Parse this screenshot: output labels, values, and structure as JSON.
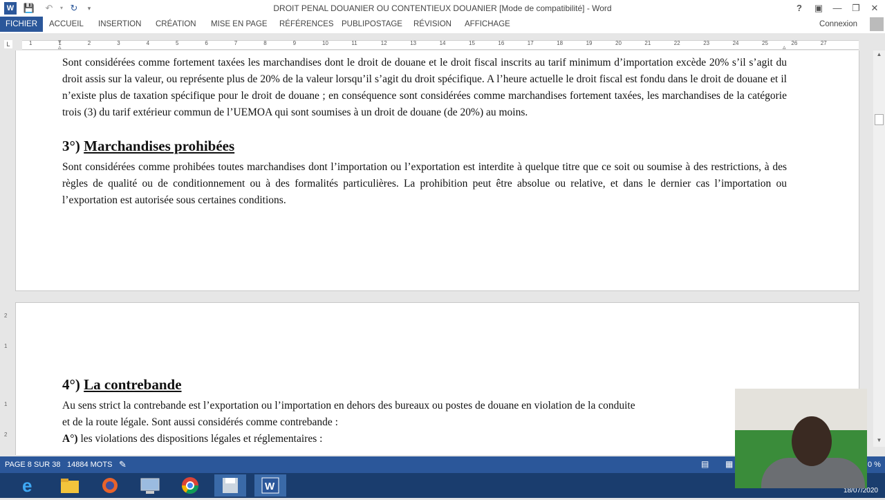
{
  "window": {
    "title": "DROIT PENAL DOUANIER OU CONTENTIEUX DOUANIER [Mode de compatibilité] - Word",
    "help": "?"
  },
  "ribbon": {
    "tabs": [
      "FICHIER",
      "ACCUEIL",
      "INSERTION",
      "CRÉATION",
      "MISE EN PAGE",
      "RÉFÉRENCES",
      "PUBLIPOSTAGE",
      "RÉVISION",
      "AFFICHAGE"
    ],
    "account": "Connexion"
  },
  "ruler": {
    "corner": "L",
    "ticks": [
      "1",
      "1",
      "2",
      "3",
      "4",
      "5",
      "6",
      "7",
      "8",
      "9",
      "10",
      "11",
      "12",
      "13",
      "14",
      "15",
      "16",
      "17",
      "18",
      "19",
      "20",
      "21",
      "22",
      "23",
      "24",
      "25",
      "26",
      "27"
    ]
  },
  "document": {
    "para1": "Sont considérées comme fortement taxées les marchandises dont le droit de douane et le droit fiscal inscrits au tarif minimum d’importation excède 20% s’il s’agit du droit assis sur la valeur, ou représente plus de 20% de la valeur lorsqu’il s’agit du droit spécifique. A l’heure actuelle le droit fiscal est fondu dans le droit de douane et il n’existe plus de taxation spécifique pour le droit de douane ; en conséquence sont considérées comme marchandises fortement taxées, les marchandises de la catégorie trois (3) du tarif extérieur commun de l’UEMOA qui sont soumises à un droit de douane (de 20%) au moins.",
    "heading3_num": "3°)",
    "heading3_text": "Marchandises prohibées",
    "para2": "Sont considérées comme prohibées toutes marchandises dont l’importation ou l’exportation est interdite à quelque titre que ce soit ou soumise à des restrictions, à des règles de qualité ou de conditionnement ou à des formalités particulières. La prohibition peut être absolue ou relative, et dans le dernier cas l’importation ou l’exportation est autorisée sous certaines conditions.",
    "heading4_num": "4°)",
    "heading4_text": "La contrebande",
    "para3_line1": "Au sens strict la contrebande est l’exportation ou l’importation en dehors des bureaux ou postes de douane en violation de la conduite",
    "para3_line2": "et de la route légale. Sont aussi considérés comme contrebande :",
    "item_a_label": "A°)",
    "item_a_text": "les violations des dispositions légales et réglementaires :"
  },
  "statusbar": {
    "page": "PAGE 8 SUR 38",
    "words": "14884 MOTS",
    "zoom": "0 %"
  },
  "taskbar": {
    "date": "18/07/2020"
  },
  "colors": {
    "word_blue": "#2b579a",
    "taskbar": "#1a3d6e"
  }
}
